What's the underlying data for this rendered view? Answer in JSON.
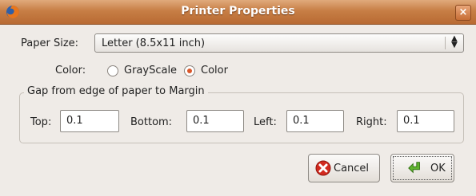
{
  "window": {
    "title": "Printer Properties",
    "close_glyph": "×"
  },
  "paper_size": {
    "label": "Paper Size:",
    "value": "Letter (8.5x11 inch)",
    "arrows": "▲▼"
  },
  "color": {
    "label": "Color:",
    "options": [
      {
        "label": "GrayScale",
        "selected": false
      },
      {
        "label": "Color",
        "selected": true
      }
    ],
    "accent": "#d9572a"
  },
  "margins": {
    "group_title": "Gap from edge of paper to Margin",
    "top": {
      "label": "Top:",
      "value": "0.1"
    },
    "bottom": {
      "label": "Bottom:",
      "value": "0.1"
    },
    "left": {
      "label": "Left:",
      "value": "0.1"
    },
    "right": {
      "label": "Right:",
      "value": "0.1"
    }
  },
  "buttons": {
    "cancel": {
      "label": "Cancel",
      "icon": "cancel-icon"
    },
    "ok": {
      "label": "OK",
      "icon": "ok-arrow-icon"
    }
  }
}
